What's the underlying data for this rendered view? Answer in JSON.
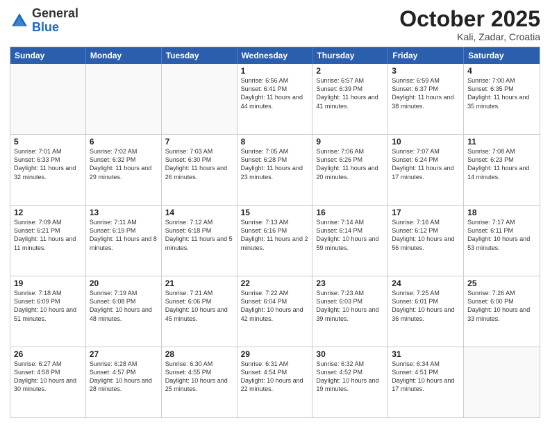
{
  "header": {
    "logo": {
      "line1": "General",
      "line2": "Blue"
    },
    "title": "October 2025",
    "location": "Kali, Zadar, Croatia"
  },
  "weekdays": [
    "Sunday",
    "Monday",
    "Tuesday",
    "Wednesday",
    "Thursday",
    "Friday",
    "Saturday"
  ],
  "weeks": [
    [
      {
        "day": "",
        "empty": true
      },
      {
        "day": "",
        "empty": true
      },
      {
        "day": "",
        "empty": true
      },
      {
        "day": "1",
        "sunrise": "Sunrise: 6:56 AM",
        "sunset": "Sunset: 6:41 PM",
        "daylight": "Daylight: 11 hours and 44 minutes."
      },
      {
        "day": "2",
        "sunrise": "Sunrise: 6:57 AM",
        "sunset": "Sunset: 6:39 PM",
        "daylight": "Daylight: 11 hours and 41 minutes."
      },
      {
        "day": "3",
        "sunrise": "Sunrise: 6:59 AM",
        "sunset": "Sunset: 6:37 PM",
        "daylight": "Daylight: 11 hours and 38 minutes."
      },
      {
        "day": "4",
        "sunrise": "Sunrise: 7:00 AM",
        "sunset": "Sunset: 6:35 PM",
        "daylight": "Daylight: 11 hours and 35 minutes."
      }
    ],
    [
      {
        "day": "5",
        "sunrise": "Sunrise: 7:01 AM",
        "sunset": "Sunset: 6:33 PM",
        "daylight": "Daylight: 11 hours and 32 minutes."
      },
      {
        "day": "6",
        "sunrise": "Sunrise: 7:02 AM",
        "sunset": "Sunset: 6:32 PM",
        "daylight": "Daylight: 11 hours and 29 minutes."
      },
      {
        "day": "7",
        "sunrise": "Sunrise: 7:03 AM",
        "sunset": "Sunset: 6:30 PM",
        "daylight": "Daylight: 11 hours and 26 minutes."
      },
      {
        "day": "8",
        "sunrise": "Sunrise: 7:05 AM",
        "sunset": "Sunset: 6:28 PM",
        "daylight": "Daylight: 11 hours and 23 minutes."
      },
      {
        "day": "9",
        "sunrise": "Sunrise: 7:06 AM",
        "sunset": "Sunset: 6:26 PM",
        "daylight": "Daylight: 11 hours and 20 minutes."
      },
      {
        "day": "10",
        "sunrise": "Sunrise: 7:07 AM",
        "sunset": "Sunset: 6:24 PM",
        "daylight": "Daylight: 11 hours and 17 minutes."
      },
      {
        "day": "11",
        "sunrise": "Sunrise: 7:08 AM",
        "sunset": "Sunset: 6:23 PM",
        "daylight": "Daylight: 11 hours and 14 minutes."
      }
    ],
    [
      {
        "day": "12",
        "sunrise": "Sunrise: 7:09 AM",
        "sunset": "Sunset: 6:21 PM",
        "daylight": "Daylight: 11 hours and 11 minutes."
      },
      {
        "day": "13",
        "sunrise": "Sunrise: 7:11 AM",
        "sunset": "Sunset: 6:19 PM",
        "daylight": "Daylight: 11 hours and 8 minutes."
      },
      {
        "day": "14",
        "sunrise": "Sunrise: 7:12 AM",
        "sunset": "Sunset: 6:18 PM",
        "daylight": "Daylight: 11 hours and 5 minutes."
      },
      {
        "day": "15",
        "sunrise": "Sunrise: 7:13 AM",
        "sunset": "Sunset: 6:16 PM",
        "daylight": "Daylight: 11 hours and 2 minutes."
      },
      {
        "day": "16",
        "sunrise": "Sunrise: 7:14 AM",
        "sunset": "Sunset: 6:14 PM",
        "daylight": "Daylight: 10 hours and 59 minutes."
      },
      {
        "day": "17",
        "sunrise": "Sunrise: 7:16 AM",
        "sunset": "Sunset: 6:12 PM",
        "daylight": "Daylight: 10 hours and 56 minutes."
      },
      {
        "day": "18",
        "sunrise": "Sunrise: 7:17 AM",
        "sunset": "Sunset: 6:11 PM",
        "daylight": "Daylight: 10 hours and 53 minutes."
      }
    ],
    [
      {
        "day": "19",
        "sunrise": "Sunrise: 7:18 AM",
        "sunset": "Sunset: 6:09 PM",
        "daylight": "Daylight: 10 hours and 51 minutes."
      },
      {
        "day": "20",
        "sunrise": "Sunrise: 7:19 AM",
        "sunset": "Sunset: 6:08 PM",
        "daylight": "Daylight: 10 hours and 48 minutes."
      },
      {
        "day": "21",
        "sunrise": "Sunrise: 7:21 AM",
        "sunset": "Sunset: 6:06 PM",
        "daylight": "Daylight: 10 hours and 45 minutes."
      },
      {
        "day": "22",
        "sunrise": "Sunrise: 7:22 AM",
        "sunset": "Sunset: 6:04 PM",
        "daylight": "Daylight: 10 hours and 42 minutes."
      },
      {
        "day": "23",
        "sunrise": "Sunrise: 7:23 AM",
        "sunset": "Sunset: 6:03 PM",
        "daylight": "Daylight: 10 hours and 39 minutes."
      },
      {
        "day": "24",
        "sunrise": "Sunrise: 7:25 AM",
        "sunset": "Sunset: 6:01 PM",
        "daylight": "Daylight: 10 hours and 36 minutes."
      },
      {
        "day": "25",
        "sunrise": "Sunrise: 7:26 AM",
        "sunset": "Sunset: 6:00 PM",
        "daylight": "Daylight: 10 hours and 33 minutes."
      }
    ],
    [
      {
        "day": "26",
        "sunrise": "Sunrise: 6:27 AM",
        "sunset": "Sunset: 4:58 PM",
        "daylight": "Daylight: 10 hours and 30 minutes."
      },
      {
        "day": "27",
        "sunrise": "Sunrise: 6:28 AM",
        "sunset": "Sunset: 4:57 PM",
        "daylight": "Daylight: 10 hours and 28 minutes."
      },
      {
        "day": "28",
        "sunrise": "Sunrise: 6:30 AM",
        "sunset": "Sunset: 4:55 PM",
        "daylight": "Daylight: 10 hours and 25 minutes."
      },
      {
        "day": "29",
        "sunrise": "Sunrise: 6:31 AM",
        "sunset": "Sunset: 4:54 PM",
        "daylight": "Daylight: 10 hours and 22 minutes."
      },
      {
        "day": "30",
        "sunrise": "Sunrise: 6:32 AM",
        "sunset": "Sunset: 4:52 PM",
        "daylight": "Daylight: 10 hours and 19 minutes."
      },
      {
        "day": "31",
        "sunrise": "Sunrise: 6:34 AM",
        "sunset": "Sunset: 4:51 PM",
        "daylight": "Daylight: 10 hours and 17 minutes."
      },
      {
        "day": "",
        "empty": true
      }
    ]
  ]
}
